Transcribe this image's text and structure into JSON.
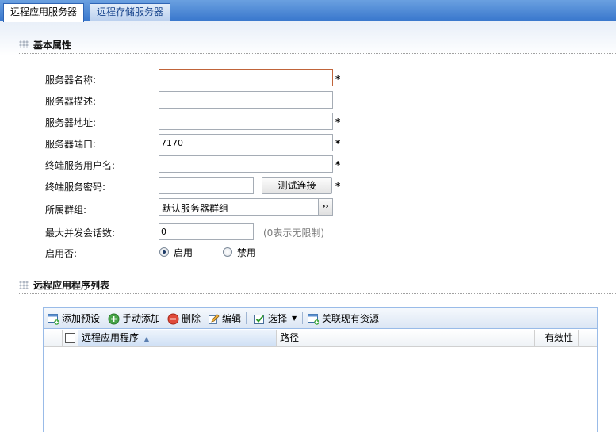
{
  "tabs": [
    {
      "label": "远程应用服务器",
      "active": true
    },
    {
      "label": "远程存储服务器",
      "active": false
    }
  ],
  "sections": {
    "basic": "基本属性",
    "apps": "远程应用程序列表"
  },
  "form": {
    "name_label": "服务器名称:",
    "name_value": "",
    "desc_label": "服务器描述:",
    "desc_value": "",
    "addr_label": "服务器地址:",
    "addr_value": "",
    "port_label": "服务器端口:",
    "port_value": "7170",
    "user_label": "终端服务用户名:",
    "user_value": "",
    "pwd_label": "终端服务密码:",
    "pwd_value": "",
    "test_button": "测试连接",
    "group_label": "所属群组:",
    "group_value": "默认服务器群组",
    "max_label": "最大并发会话数:",
    "max_value": "0",
    "max_hint": "(0表示无限制)",
    "enable_label": "启用否:",
    "enable_on": "启用",
    "enable_off": "禁用",
    "enabled": true,
    "required_mark": "*"
  },
  "toolbar": {
    "add_preset": "添加预设",
    "add_manual": "手动添加",
    "delete": "删除",
    "edit": "编辑",
    "select": "选择",
    "link_existing": "关联现有资源"
  },
  "table": {
    "columns": [
      "远程应用程序",
      "路径",
      "有效性"
    ],
    "sort_indicator": "▲",
    "rows": []
  },
  "icons": {
    "add_preset": "window-add-icon",
    "add_manual": "green-plus-icon",
    "delete": "red-minus-icon",
    "edit": "edit-pencil-icon",
    "select": "checkbox-icon",
    "link_existing": "window-link-icon",
    "group_dropdown": "double-chevron-right-icon"
  }
}
